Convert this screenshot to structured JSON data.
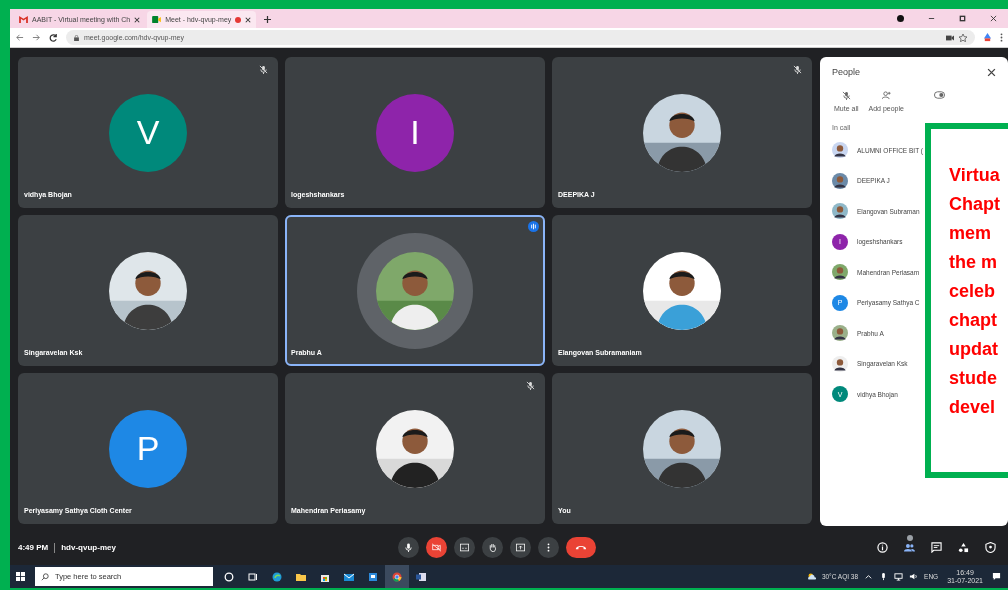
{
  "browser": {
    "tabs": [
      {
        "title": "AABIT - Virtual meeting with Ch",
        "selected": false,
        "recording": false
      },
      {
        "title": "Meet - hdv-qvup-mey",
        "selected": true,
        "recording": true
      }
    ],
    "url": "meet.google.com/hdv-qvup-mey"
  },
  "tiles": [
    {
      "name": "vidhya Bhojan",
      "kind": "letter",
      "letter": "V",
      "color": "#00897b",
      "muted": true,
      "speaking": false
    },
    {
      "name": "logeshshankars",
      "kind": "letter",
      "letter": "I",
      "color": "#8e24aa",
      "muted": false,
      "speaking": false
    },
    {
      "name": "DEEPIKA J",
      "kind": "picture",
      "muted": true,
      "speaking": false
    },
    {
      "name": "Singaravelan Ksk",
      "kind": "picture",
      "muted": false,
      "speaking": false
    },
    {
      "name": "Prabhu A",
      "kind": "picture",
      "muted": false,
      "speaking": true
    },
    {
      "name": "Elangovan Subramaniam",
      "kind": "picture",
      "muted": false,
      "speaking": false
    },
    {
      "name": "Periyasamy Sathya Cloth Center",
      "kind": "letter",
      "letter": "P",
      "color": "#1e88e5",
      "muted": false,
      "speaking": false
    },
    {
      "name": "Mahendran Periasamy",
      "kind": "picture",
      "muted": true,
      "speaking": false
    },
    {
      "name": "You",
      "kind": "picture",
      "muted": false,
      "speaking": false
    }
  ],
  "people_panel": {
    "title": "People",
    "actions": [
      "Mute all",
      "Add people"
    ],
    "section": "In call",
    "participants": [
      {
        "name": "ALUMNI OFFICE BIT (",
        "kind": "picture"
      },
      {
        "name": "DEEPIKA J",
        "kind": "picture"
      },
      {
        "name": "Elangovan Subraman",
        "kind": "picture"
      },
      {
        "name": "logeshshankars",
        "kind": "letter",
        "letter": "I",
        "color": "#8e24aa"
      },
      {
        "name": "Mahendran Periasam",
        "kind": "picture"
      },
      {
        "name": "Periyasamy Sathya C",
        "kind": "letter",
        "letter": "P",
        "color": "#1e88e5"
      },
      {
        "name": "Prabhu A",
        "kind": "picture"
      },
      {
        "name": "Singaravelan Ksk",
        "kind": "picture"
      },
      {
        "name": "vidhya Bhojan",
        "kind": "letter",
        "letter": "V",
        "color": "#00897b"
      }
    ]
  },
  "meeting_bar": {
    "time": "4:49 PM",
    "code": "hdv-qvup-mey"
  },
  "overlay": {
    "text": "Virtua\nChapt\nmem\nthe m\nceleb\nchapt\nupdat\nstude\ndevel"
  },
  "taskbar": {
    "search_placeholder": "Type here to search",
    "weather": "30°C AQI 38",
    "language": "ENG",
    "time": "16:49",
    "date": "31-07-2021"
  }
}
